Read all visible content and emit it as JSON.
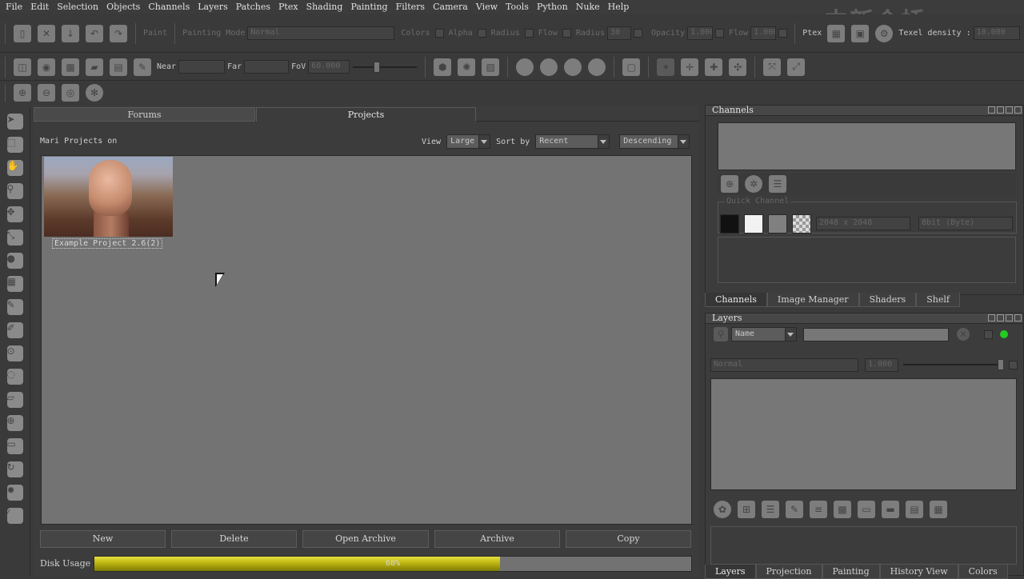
{
  "menu": [
    "File",
    "Edit",
    "Selection",
    "Objects",
    "Channels",
    "Layers",
    "Patches",
    "Ptex",
    "Shading",
    "Painting",
    "Filters",
    "Camera",
    "View",
    "Tools",
    "Python",
    "Nuke",
    "Help"
  ],
  "watermark": "中新会桥",
  "toolbar1": {
    "paint": "Paint",
    "painting_mode_label": "Painting Mode",
    "painting_mode_value": "Normal",
    "colors": "Colors",
    "alpha": "Alpha",
    "radius": "Radius",
    "flow": "Flow",
    "radius2": "Radius",
    "radius_value": "30",
    "opacity": "Opacity",
    "opacity_value": "1.000",
    "flow2": "Flow",
    "flow_value": "1.000",
    "ptex": "Ptex",
    "texel_density": "Texel density :",
    "texel_value": "10.000"
  },
  "toolbar2": {
    "near": "Near",
    "far": "Far",
    "fov": "FoV",
    "fov_value": "60.000"
  },
  "tabs": {
    "forums": "Forums",
    "projects": "Projects"
  },
  "projects": {
    "header": "Mari Projects on",
    "view_label": "View",
    "view_value": "Large",
    "sort_label": "Sort by",
    "sort_value": "Recent",
    "order_value": "Descending",
    "items": [
      {
        "name": "Example Project 2.6(2)"
      }
    ],
    "buttons": {
      "new": "New",
      "delete": "Delete",
      "open_archive": "Open Archive",
      "archive": "Archive",
      "copy": "Copy"
    },
    "disk_label": "Disk Usage",
    "disk_percent": 68,
    "disk_text": "68%"
  },
  "channels_panel": {
    "title": "Channels",
    "quick_channel": "Quick Channel",
    "size": "2048 x 2048",
    "depth": "8bit (Byte)",
    "tabs": [
      "Channels",
      "Image Manager",
      "Shaders",
      "Shelf"
    ]
  },
  "layers_panel": {
    "title": "Layers",
    "filter": "Name",
    "blend": "Normal",
    "opacity": "1.000",
    "tabs": [
      "Layers",
      "Projection",
      "Painting",
      "History View",
      "Colors"
    ]
  },
  "colors": {
    "accent": "#e6df3c",
    "status_green": "#22cc22"
  }
}
